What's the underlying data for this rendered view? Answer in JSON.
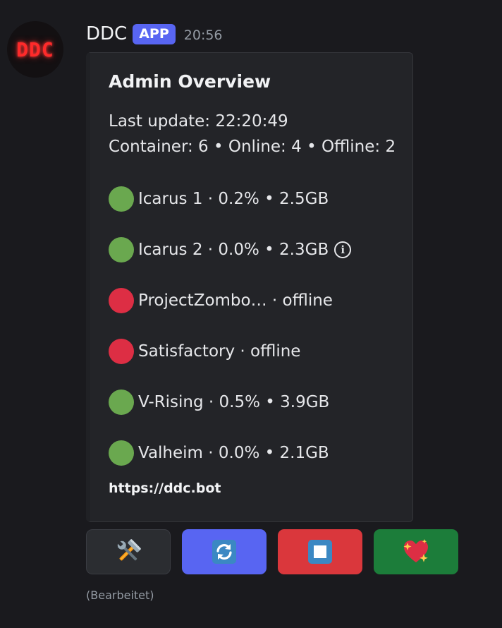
{
  "author": {
    "avatar_text": "DDC",
    "name": "DDC",
    "badge": "APP",
    "time": "20:56"
  },
  "embed": {
    "title": "Admin Overview",
    "last_update": "Last update: 22:20:49",
    "summary": "Container: 6 • Online: 4 • Offline: 2",
    "servers": [
      {
        "status": "online",
        "text": "Icarus 1 · 0.2% • 2.5GB",
        "info": false
      },
      {
        "status": "online",
        "text": "Icarus 2 · 0.0% • 2.3GB",
        "info": true
      },
      {
        "status": "offline",
        "text": "ProjectZombo… · offline",
        "info": false
      },
      {
        "status": "offline",
        "text": "Satisfactory · offline",
        "info": false
      },
      {
        "status": "online",
        "text": "V-Rising · 0.5% • 3.9GB",
        "info": false
      },
      {
        "status": "online",
        "text": "Valheim · 0.0% • 2.1GB",
        "info": false
      }
    ],
    "footer": "https://ddc.bot"
  },
  "buttons": [
    {
      "icon": "tools-icon",
      "style": "secondary"
    },
    {
      "icon": "refresh-icon",
      "style": "primary"
    },
    {
      "icon": "stop-icon",
      "style": "danger"
    },
    {
      "icon": "sparkling-heart-icon",
      "style": "success"
    }
  ],
  "edited": "(Bearbeitet)",
  "colors": {
    "online": "#6aa84f",
    "offline": "#dd2e44",
    "blurple": "#5865f2",
    "danger": "#da373c",
    "success": "#1c7d3a"
  }
}
